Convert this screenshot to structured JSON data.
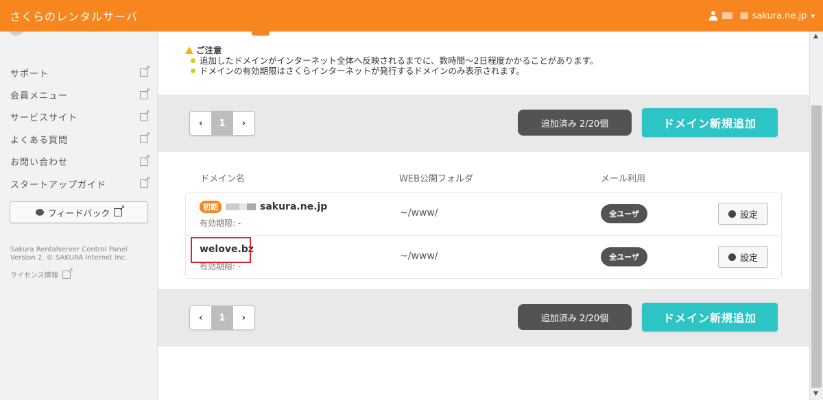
{
  "header": {
    "brand": "さくらのレンタルサーバ",
    "account_domain": "sakura.ne.jp",
    "account_chevron": "▾"
  },
  "sidebar": {
    "items": [
      {
        "label": "サポート"
      },
      {
        "label": "会員メニュー"
      },
      {
        "label": "サービスサイト"
      },
      {
        "label": "よくある質問"
      },
      {
        "label": "お問い合わせ"
      },
      {
        "label": "スタートアップガイド"
      }
    ],
    "feedback_label": "フィードバック",
    "copyright": "Sakura Rentalserver Control Panel Version 2. © SAKURA Internet Inc.",
    "license_label": "ライセンス情報"
  },
  "notice": {
    "title": "ご注意",
    "lines": [
      "追加したドメインがインターネット全体へ反映されるまでに、数時間〜2日程度かかることがあります。",
      "ドメインの有効期限はさくらインターネットが発行するドメインのみ表示されます。"
    ]
  },
  "toolbar": {
    "prev": "‹",
    "page": "1",
    "next": "›",
    "count_label": "追加済み 2/20個",
    "add_label": "ドメイン新規追加"
  },
  "table": {
    "columns": [
      "ドメイン名",
      "WEB公開フォルダ",
      "メール利用"
    ],
    "rows": [
      {
        "badge": "初期",
        "domain": "sakura.ne.jp",
        "expiry": "有効期限: -",
        "folder": "~/www/",
        "mail": "全ユーザ",
        "action": "設定"
      },
      {
        "badge": "",
        "domain": "welove.bz",
        "expiry": "有効期限: -",
        "folder": "~/www/",
        "mail": "全ユーザ",
        "action": "設定"
      }
    ]
  },
  "scrollbar": {
    "up": "▲",
    "down": "▼"
  }
}
